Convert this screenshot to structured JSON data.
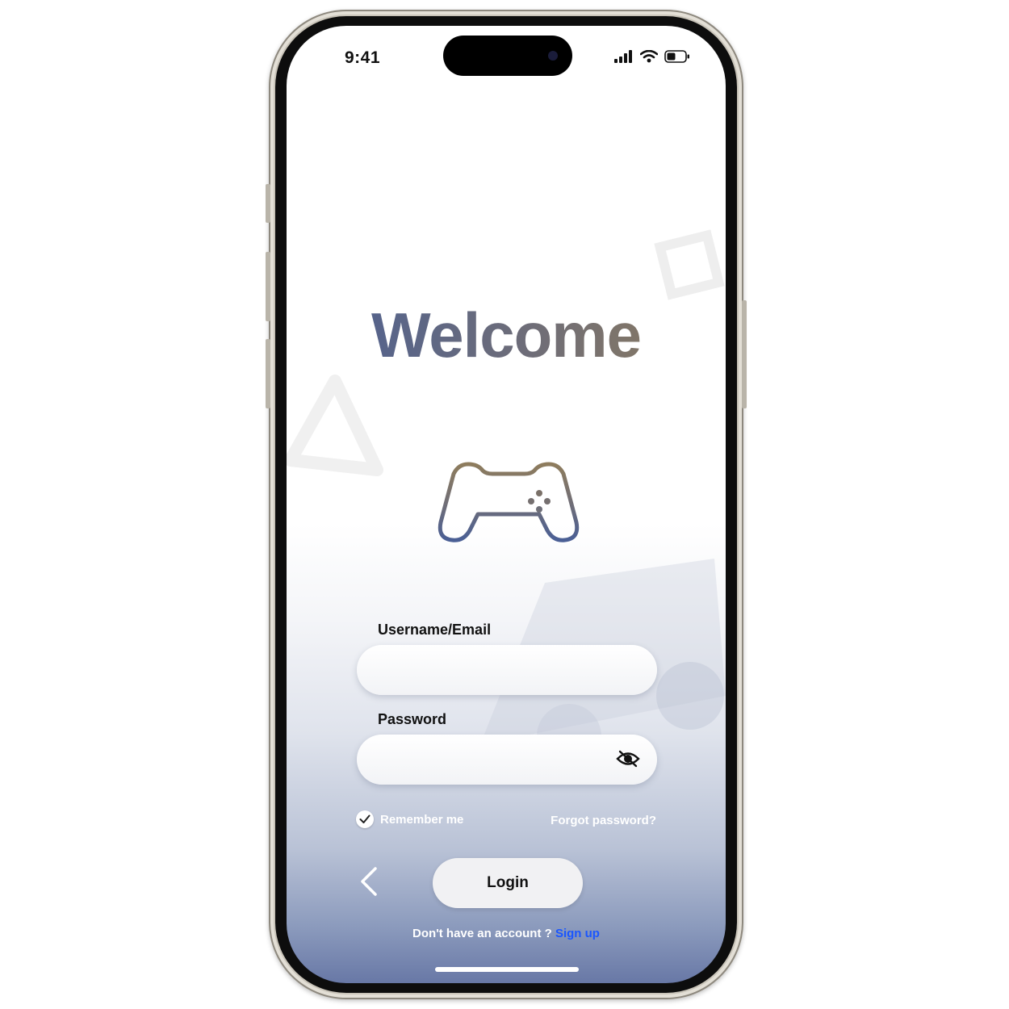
{
  "status_bar": {
    "time": "9:41"
  },
  "title": "Welcome",
  "form": {
    "username_label": "Username/Email",
    "username_value": "",
    "password_label": "Password",
    "password_value": "",
    "remember_label": "Remember me",
    "remember_checked": true,
    "forgot_label": "Forgot password?"
  },
  "actions": {
    "login_label": "Login",
    "no_account_text": "Don't have an account ?",
    "signup_label": "Sign up"
  },
  "icons": {
    "gamepad": "gamepad-icon",
    "eye": "eye-slash-icon",
    "back": "chevron-left-icon",
    "check": "check-icon"
  },
  "colors": {
    "title_gradient_start": "#4a5f95",
    "title_gradient_end": "#8e7c5d",
    "signup_link": "#1a56ff",
    "background_bottom": "#6878a6"
  }
}
